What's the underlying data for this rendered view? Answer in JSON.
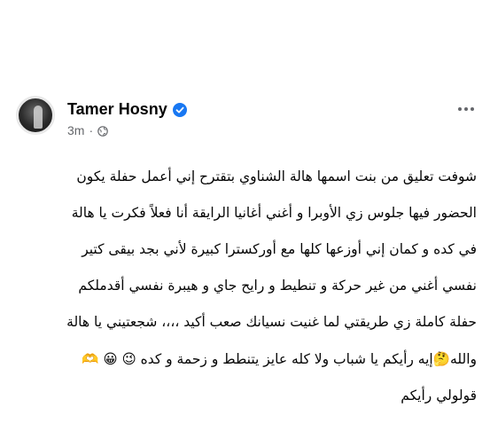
{
  "post": {
    "author": "Tamer Hosny",
    "time": "3m",
    "separator": "·",
    "lines": [
      "شوفت تعليق من بنت اسمها هالة الشناوي بتقترح إني أعمل حفلة يكون",
      "الحضور فيها جلوس زي الأوبرا و أغني أغانيا الرايقة أنا فعلاً فكرت يا هالة",
      "في كده و كمان إني أوزعها كلها مع أوركسترا كبيرة  لأني بجد بيقى كتير",
      "نفسي أغني من غير حركة و تنطيط و رايح جاي و هيبرة  نفسي أقدملكم",
      "حفلة كاملة زي طريقتي لما غنيت نسيانك صعب أكيد ،،،، شجعتيني يا هالة",
      "والله🤔إيه رأيكم يا شباب ولا كله عايز يتنطط و زحمة و كده 😉 😀 🫶",
      "قولولي رأيكم"
    ]
  },
  "icons": {
    "verified": "verified-badge-icon",
    "globe": "globe-icon",
    "more": "more-options-icon"
  },
  "colors": {
    "verified_blue": "#1877f2",
    "meta_gray": "#65676b",
    "text": "#050505"
  }
}
